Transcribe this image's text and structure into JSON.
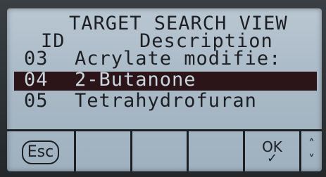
{
  "screen": {
    "title": "TARGET SEARCH VIEW",
    "columns": {
      "id": "ID",
      "description": "Description"
    },
    "rows": [
      {
        "id": "03",
        "description": "Acrylate modifie:"
      },
      {
        "id": "04",
        "description": "2-Butanone"
      },
      {
        "id": "05",
        "description": "Tetrahydrofuran"
      }
    ],
    "selected_row_index": 1
  },
  "softkeys": {
    "esc_label": "Esc",
    "ok_label": "OK",
    "ok_icon": "check-mark",
    "up_icon": "chevron-up-icon",
    "down_icon": "chevron-down-icon"
  },
  "colors": {
    "lcd_background": "#a9b9c6",
    "text": "#1d1f24",
    "selection": "#2b1518"
  }
}
